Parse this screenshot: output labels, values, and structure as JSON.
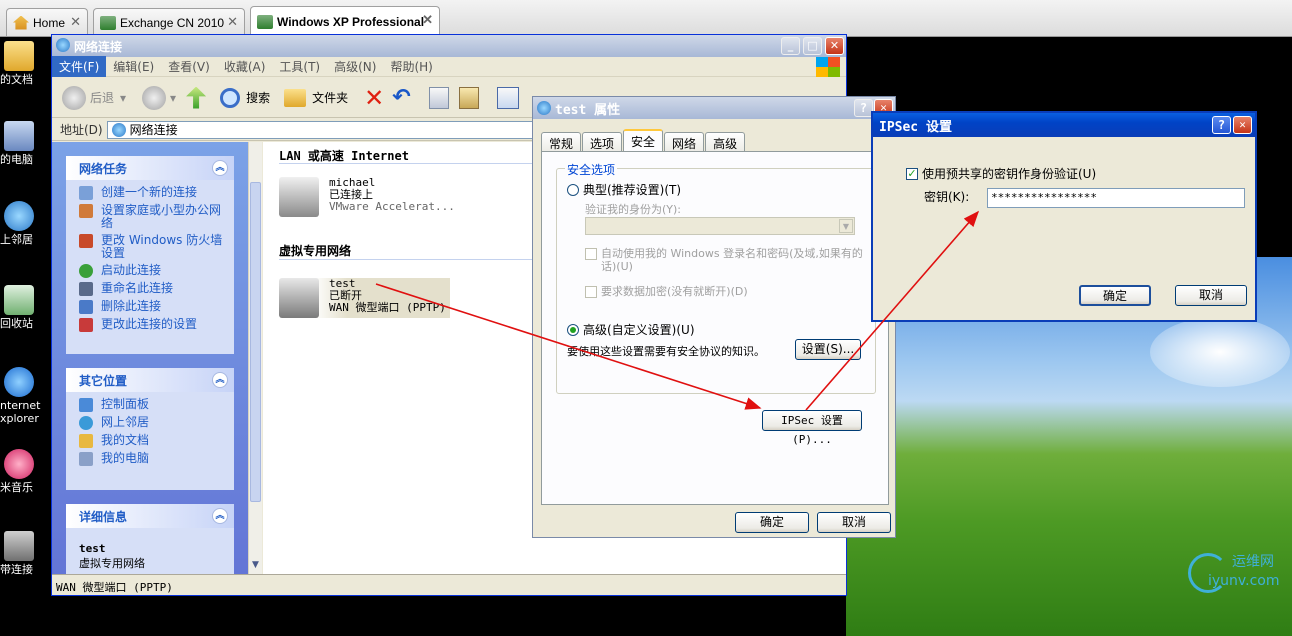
{
  "browser_tabs": [
    {
      "label": "Home"
    },
    {
      "label": "Exchange CN 2010"
    },
    {
      "label": "Windows XP Professional"
    }
  ],
  "desktop_icons": [
    {
      "label": "的文档"
    },
    {
      "label": "的电脑"
    },
    {
      "label": "上邻居"
    },
    {
      "label": "回收站"
    },
    {
      "label": "nternet xplorer"
    },
    {
      "label": "米音乐"
    },
    {
      "label": "带连接"
    }
  ],
  "explorer": {
    "title": "网络连接",
    "menu": [
      "文件(F)",
      "编辑(E)",
      "查看(V)",
      "收藏(A)",
      "工具(T)",
      "高级(N)",
      "帮助(H)"
    ],
    "toolbar": {
      "back": "后退",
      "search": "搜索",
      "folders": "文件夹"
    },
    "address_label": "地址(D)",
    "address_value": "网络连接",
    "tasks": {
      "title": "网络任务",
      "items": [
        "创建一个新的连接",
        "设置家庭或小型办公网络",
        "更改 Windows 防火墙设置",
        "启动此连接",
        "重命名此连接",
        "删除此连接",
        "更改此连接的设置"
      ]
    },
    "other_places": {
      "title": "其它位置",
      "items": [
        "控制面板",
        "网上邻居",
        "我的文档",
        "我的电脑"
      ]
    },
    "details": {
      "title": "详细信息",
      "line1": "test",
      "line2": "虚拟专用网络"
    },
    "group_lan": "LAN 或高速 Internet",
    "group_vpn": "虚拟专用网络",
    "conn1": {
      "name": "michael",
      "status": "已连接上",
      "device": "VMware Accelerat..."
    },
    "conn2": {
      "name": "test",
      "status": "已断开",
      "device": "WAN 微型端口 (PPTP)"
    },
    "status": "WAN 微型端口 (PPTP)"
  },
  "props": {
    "title": "test 属性",
    "tabs": [
      "常规",
      "选项",
      "安全",
      "网络",
      "高级"
    ],
    "legend": "安全选项",
    "typical": "典型(推荐设置)(T)",
    "verify": "验证我的身份为(Y):",
    "auto_login": "自动使用我的 Windows 登录名和密码(及域,如果有的话)(U)",
    "encrypt": "要求数据加密(没有就断开)(D)",
    "advanced": "高级(自定义设置)(U)",
    "adv_desc": "要使用这些设置需要有安全协议的知识。",
    "settings": "设置(S)...",
    "ipsec": "IPSec 设置(P)...",
    "ok": "确定",
    "cancel": "取消"
  },
  "ipsec": {
    "title": "IPSec 设置",
    "checkbox": "使用预共享的密钥作身份验证(U)",
    "key_label": "密钥(K):",
    "key_value": "****************",
    "ok": "确定",
    "cancel": "取消"
  },
  "watermark": {
    "cn": "运维网",
    "url": "iyunv.com"
  }
}
